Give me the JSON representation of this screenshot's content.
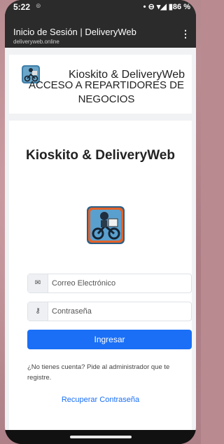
{
  "status_bar": {
    "time": "5:22",
    "indicator": "⊚",
    "icons": "• ⊖ ▾◢ ▮86 %"
  },
  "browser": {
    "title": "Inicio de Sesión | DeliveryWeb",
    "url": "deliveryweb.online",
    "menu": "⋮"
  },
  "header": {
    "brand": "Kioskito & DeliveryWeb",
    "heading": "ACCESO A REPARTIDORES DE NEGOCIOS"
  },
  "login": {
    "app_title": "Kioskito & DeliveryWeb",
    "email_placeholder": "Correo Electrónico",
    "password_placeholder": "Contraseña",
    "submit_label": "Ingresar",
    "note": "¿No tienes cuenta? Pide al administrador que te registre.",
    "recover_link": "Recuperar Contraseña"
  },
  "icons": {
    "email": "envelope-icon",
    "password": "key-icon",
    "logo": "delivery-motorcycle-logo"
  },
  "colors": {
    "primary": "#1a6ff6",
    "browser_bar": "#2b2b2b",
    "page_bg": "#f1f2f4"
  }
}
